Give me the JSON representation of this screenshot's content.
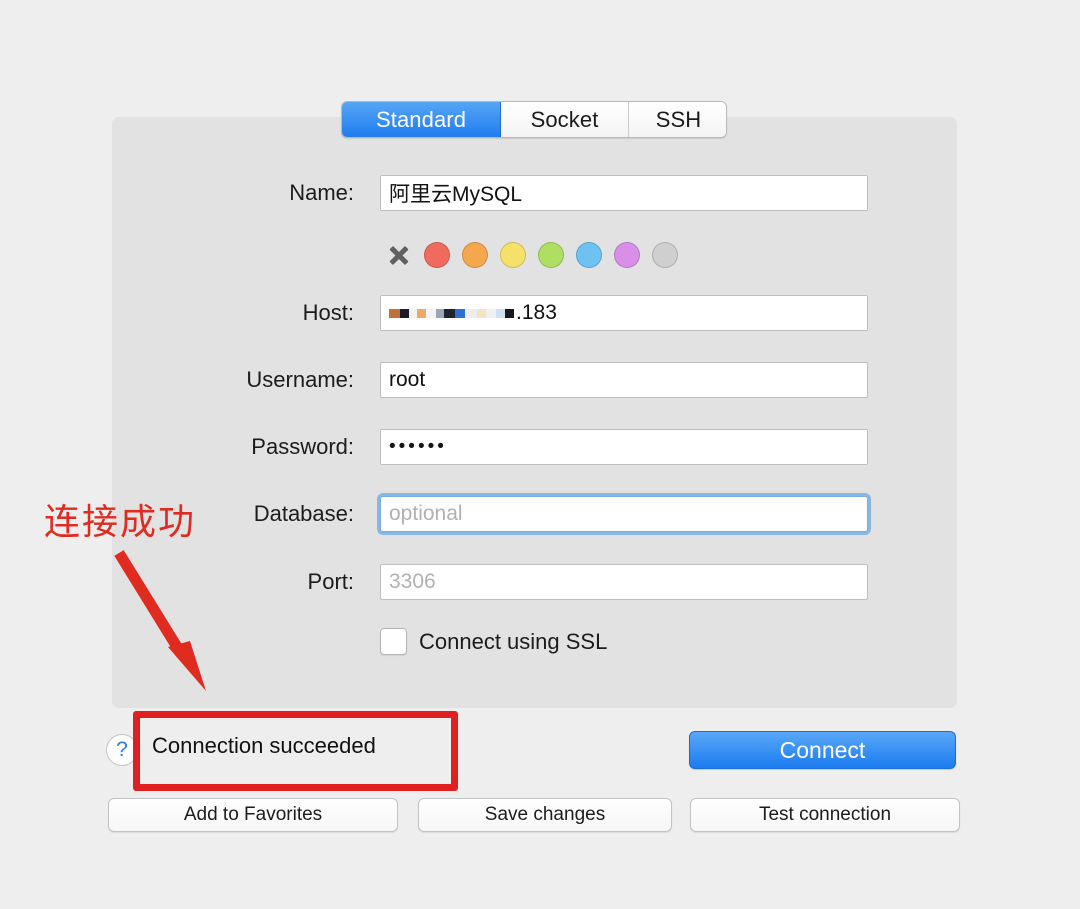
{
  "tabs": [
    {
      "label": "Standard",
      "active": true
    },
    {
      "label": "Socket",
      "active": false
    },
    {
      "label": "SSH",
      "active": false
    }
  ],
  "form": {
    "name": {
      "label": "Name:",
      "value": "阿里云MySQL",
      "placeholder": ""
    },
    "host": {
      "label": "Host:",
      "value": ".183",
      "placeholder": "",
      "redacted": true
    },
    "username": {
      "label": "Username:",
      "value": "root",
      "placeholder": ""
    },
    "password": {
      "label": "Password:",
      "value": "••••••",
      "placeholder": ""
    },
    "database": {
      "label": "Database:",
      "value": "",
      "placeholder": "optional",
      "focused": true
    },
    "port": {
      "label": "Port:",
      "value": "",
      "placeholder": "3306"
    }
  },
  "colors": {
    "clear_icon": "x-mark-icon",
    "swatches": [
      {
        "name": "red",
        "hex": "#f16a5e"
      },
      {
        "name": "orange",
        "hex": "#f5a74f"
      },
      {
        "name": "yellow",
        "hex": "#f5e16a"
      },
      {
        "name": "green",
        "hex": "#aede62"
      },
      {
        "name": "blue",
        "hex": "#6ec2f2"
      },
      {
        "name": "purple",
        "hex": "#d98fe8"
      },
      {
        "name": "grey",
        "hex": "#cfcfcf"
      }
    ]
  },
  "ssl": {
    "label": "Connect using SSL",
    "checked": false
  },
  "footer": {
    "help_label": "?",
    "status": "Connection succeeded",
    "connect_label": "Connect",
    "buttons": [
      "Add to Favorites",
      "Save changes",
      "Test connection"
    ]
  },
  "annotations": {
    "note_text": "连接成功",
    "note_color": "#e02b20",
    "highlight_color": "#e02020"
  }
}
